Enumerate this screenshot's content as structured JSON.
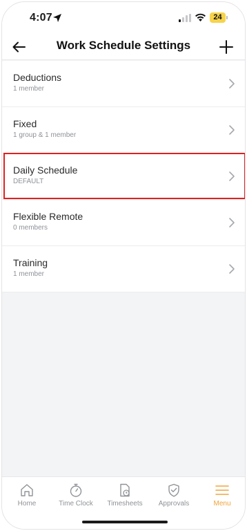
{
  "status_bar": {
    "time": "4:07",
    "battery_level": "24",
    "icons": [
      "location-arrow-icon",
      "cellular-signal-icon",
      "wifi-icon",
      "battery-icon"
    ]
  },
  "header": {
    "title": "Work Schedule Settings",
    "back_icon": "arrow-left-icon",
    "add_icon": "plus-icon"
  },
  "schedules": [
    {
      "title": "Deductions",
      "subtitle": "1 member"
    },
    {
      "title": "Fixed",
      "subtitle": "1 group & 1 member"
    },
    {
      "title": "Daily Schedule",
      "subtitle": "DEFAULT"
    },
    {
      "title": "Flexible Remote",
      "subtitle": "0 members"
    },
    {
      "title": "Training",
      "subtitle": "1 member"
    }
  ],
  "tab_bar": {
    "tabs": [
      {
        "label": "Home",
        "icon": "home-icon",
        "active": false
      },
      {
        "label": "Time Clock",
        "icon": "stopwatch-icon",
        "active": false
      },
      {
        "label": "Timesheets",
        "icon": "timesheet-icon",
        "active": false
      },
      {
        "label": "Approvals",
        "icon": "shield-check-icon",
        "active": false
      },
      {
        "label": "Menu",
        "icon": "hamburger-menu-icon",
        "active": true
      }
    ]
  },
  "colors": {
    "accent": "#f0a33a",
    "highlight": "#e02020",
    "background": "#f2f4f6",
    "battery": "#f6d34a"
  }
}
